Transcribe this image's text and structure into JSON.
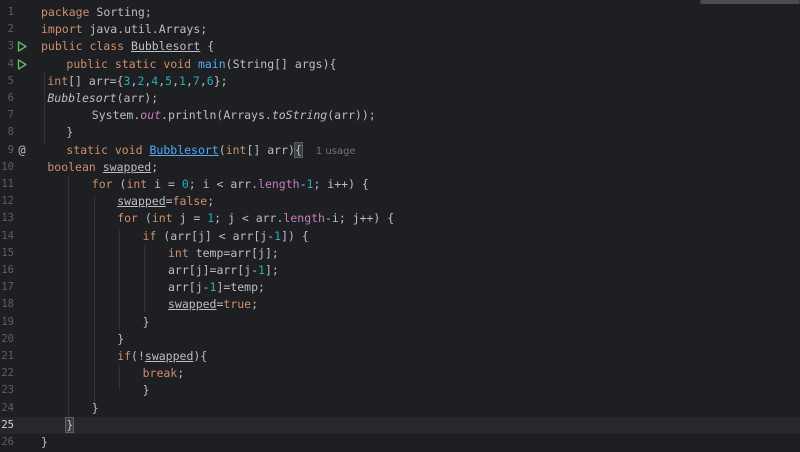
{
  "colors": {
    "background": "#1e1f22",
    "keyword": "#cf8e6d",
    "function": "#56a8f5",
    "number": "#2aacb8",
    "member": "#c77dbb",
    "text": "#bcbec4",
    "line_number": "#5b5f66",
    "run_icon": "#5fb865"
  },
  "editor": {
    "current_line": 25,
    "gutter_icons": {
      "run": "run-icon",
      "override": "at-sign-icon"
    },
    "lines": [
      {
        "num": "1",
        "indent": 0,
        "tokens": [
          {
            "t": "package",
            "c": "kw"
          },
          {
            "t": " Sorting;"
          }
        ]
      },
      {
        "num": "2",
        "indent": 0,
        "tokens": [
          {
            "t": "import",
            "c": "kw"
          },
          {
            "t": " java.util.Arrays;"
          }
        ]
      },
      {
        "num": "3",
        "indent": 0,
        "icon": "run",
        "tokens": [
          {
            "t": "public class",
            "c": "kw"
          },
          {
            "t": " "
          },
          {
            "t": "Bubblesort",
            "c": "var-u"
          },
          {
            "t": " {"
          }
        ]
      },
      {
        "num": "4",
        "indent": 4,
        "icon": "run",
        "tokens": [
          {
            "t": "public static void",
            "c": "kw"
          },
          {
            "t": " "
          },
          {
            "t": "main",
            "c": "fn"
          },
          {
            "t": "(String[] args){"
          }
        ]
      },
      {
        "num": "5",
        "indent": 1,
        "tokens": [
          {
            "t": "int",
            "c": "kw"
          },
          {
            "t": "[] arr={"
          },
          {
            "t": "3",
            "c": "num"
          },
          {
            "t": ","
          },
          {
            "t": "2",
            "c": "num"
          },
          {
            "t": ","
          },
          {
            "t": "4",
            "c": "num"
          },
          {
            "t": ","
          },
          {
            "t": "5",
            "c": "num"
          },
          {
            "t": ","
          },
          {
            "t": "1",
            "c": "num"
          },
          {
            "t": ","
          },
          {
            "t": "7",
            "c": "num"
          },
          {
            "t": ","
          },
          {
            "t": "6",
            "c": "num"
          },
          {
            "t": "};"
          }
        ]
      },
      {
        "num": "6",
        "indent": 1,
        "tokens": [
          {
            "t": "Bubblesort",
            "c": "it"
          },
          {
            "t": "(arr);"
          }
        ]
      },
      {
        "num": "7",
        "indent": 8,
        "tokens": [
          {
            "t": "System."
          },
          {
            "t": "out",
            "c": "mem it"
          },
          {
            "t": ".println(Arrays."
          },
          {
            "t": "toString",
            "c": "it"
          },
          {
            "t": "(arr));"
          }
        ]
      },
      {
        "num": "8",
        "indent": 4,
        "tokens": [
          {
            "t": "}"
          }
        ]
      },
      {
        "num": "9",
        "indent": 4,
        "icon": "override",
        "tokens": [
          {
            "t": "static void",
            "c": "kw"
          },
          {
            "t": " "
          },
          {
            "t": "Bubblesort",
            "c": "decl"
          },
          {
            "t": "("
          },
          {
            "t": "int",
            "c": "kw"
          },
          {
            "t": "[] arr)"
          },
          {
            "t": "{",
            "c": "brace-hl"
          }
        ],
        "hint": "1 usage"
      },
      {
        "num": "10",
        "indent": 1,
        "tokens": [
          {
            "t": "boolean",
            "c": "kw"
          },
          {
            "t": " "
          },
          {
            "t": "swapped",
            "c": "var-u"
          },
          {
            "t": ";"
          }
        ]
      },
      {
        "num": "11",
        "indent": 8,
        "tokens": [
          {
            "t": "for",
            "c": "kw"
          },
          {
            "t": " ("
          },
          {
            "t": "int",
            "c": "kw"
          },
          {
            "t": " i = "
          },
          {
            "t": "0",
            "c": "num"
          },
          {
            "t": "; i < arr."
          },
          {
            "t": "length",
            "c": "mem"
          },
          {
            "t": "-"
          },
          {
            "t": "1",
            "c": "num"
          },
          {
            "t": "; i++) {"
          }
        ]
      },
      {
        "num": "12",
        "indent": 12,
        "tokens": [
          {
            "t": "swapped",
            "c": "var-u"
          },
          {
            "t": "="
          },
          {
            "t": "false",
            "c": "kw"
          },
          {
            "t": ";"
          }
        ]
      },
      {
        "num": "13",
        "indent": 12,
        "tokens": [
          {
            "t": "for",
            "c": "kw"
          },
          {
            "t": " ("
          },
          {
            "t": "int",
            "c": "kw"
          },
          {
            "t": " j = "
          },
          {
            "t": "1",
            "c": "num"
          },
          {
            "t": "; j < arr."
          },
          {
            "t": "length",
            "c": "mem"
          },
          {
            "t": "-i; j++) {"
          }
        ]
      },
      {
        "num": "14",
        "indent": 16,
        "tokens": [
          {
            "t": "if",
            "c": "kw"
          },
          {
            "t": " (arr[j] < arr[j-"
          },
          {
            "t": "1",
            "c": "num"
          },
          {
            "t": "]) {"
          }
        ]
      },
      {
        "num": "15",
        "indent": 20,
        "tokens": [
          {
            "t": "int",
            "c": "kw"
          },
          {
            "t": " temp=arr[j];"
          }
        ]
      },
      {
        "num": "16",
        "indent": 20,
        "tokens": [
          {
            "t": "arr[j]=arr[j-"
          },
          {
            "t": "1",
            "c": "num"
          },
          {
            "t": "];"
          }
        ]
      },
      {
        "num": "17",
        "indent": 20,
        "tokens": [
          {
            "t": "arr[j-"
          },
          {
            "t": "1",
            "c": "num"
          },
          {
            "t": "]=temp;"
          }
        ]
      },
      {
        "num": "18",
        "indent": 20,
        "tokens": [
          {
            "t": "swapped",
            "c": "var-u"
          },
          {
            "t": "="
          },
          {
            "t": "true",
            "c": "kw"
          },
          {
            "t": ";"
          }
        ]
      },
      {
        "num": "19",
        "indent": 16,
        "tokens": [
          {
            "t": "}"
          }
        ]
      },
      {
        "num": "20",
        "indent": 12,
        "tokens": [
          {
            "t": "}"
          }
        ]
      },
      {
        "num": "21",
        "indent": 12,
        "tokens": [
          {
            "t": "if",
            "c": "kw"
          },
          {
            "t": "(!"
          },
          {
            "t": "swapped",
            "c": "var-u"
          },
          {
            "t": "){"
          }
        ]
      },
      {
        "num": "22",
        "indent": 16,
        "tokens": [
          {
            "t": "break",
            "c": "kw"
          },
          {
            "t": ";"
          }
        ]
      },
      {
        "num": "23",
        "indent": 16,
        "tokens": [
          {
            "t": "}"
          }
        ]
      },
      {
        "num": "24",
        "indent": 8,
        "tokens": [
          {
            "t": "}"
          }
        ]
      },
      {
        "num": "25",
        "indent": 4,
        "tokens": [
          {
            "t": "}",
            "c": "brace-hl"
          }
        ]
      },
      {
        "num": "26",
        "indent": 0,
        "tokens": [
          {
            "t": "}"
          }
        ]
      }
    ]
  }
}
